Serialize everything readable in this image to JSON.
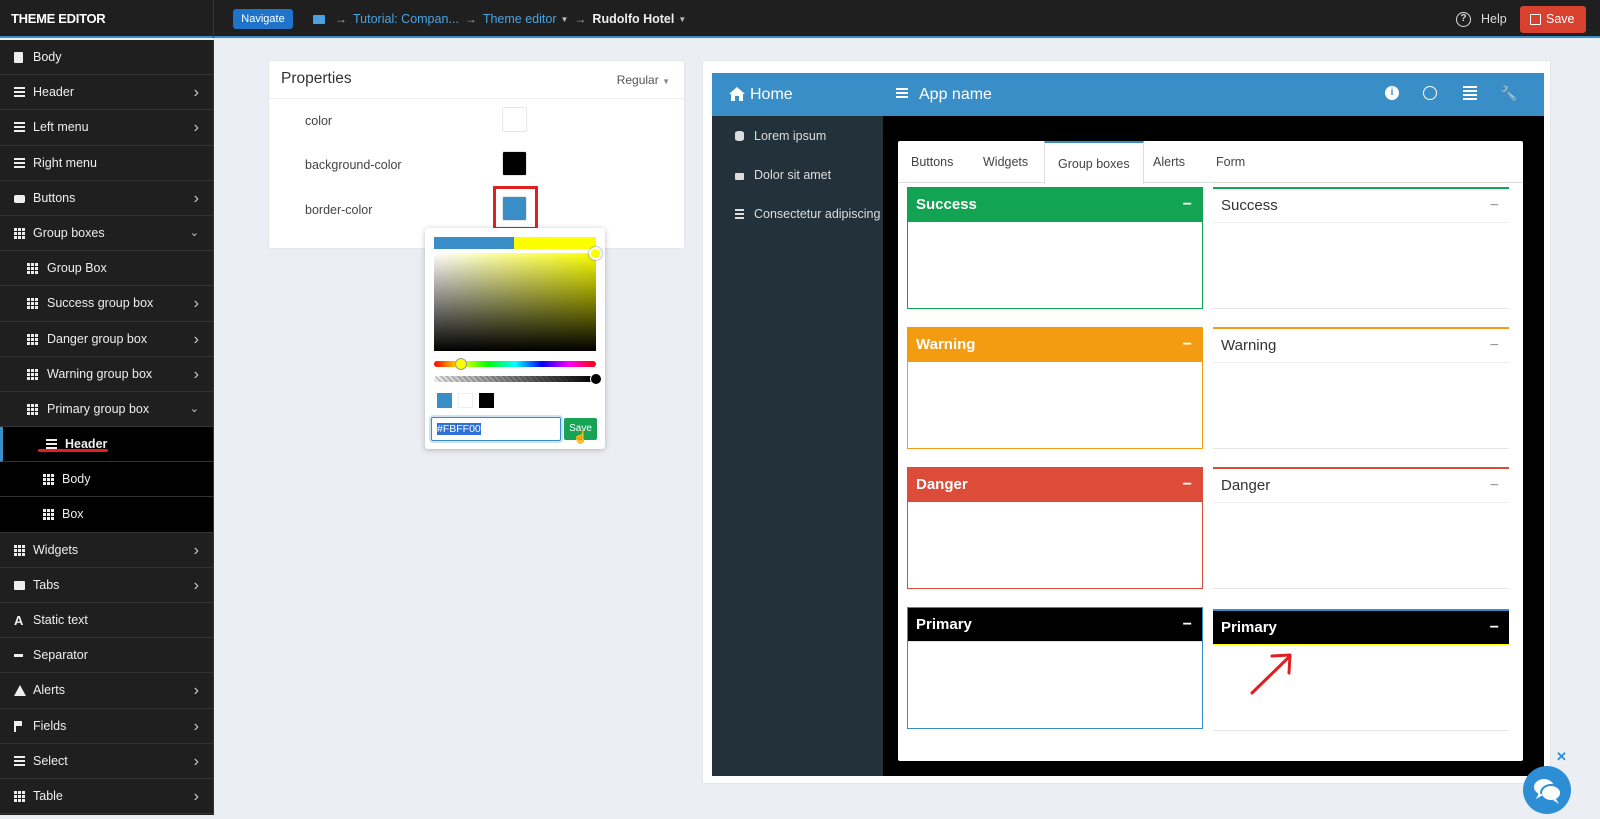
{
  "topbar": {
    "brand": "THEME EDITOR",
    "navigate": "Navigate",
    "crumb1": "Tutorial: Compan...",
    "crumb2": "Theme editor",
    "crumb3": "Rudolfo Hotel",
    "help": "Help",
    "save": "Save"
  },
  "sidebar": {
    "items": [
      {
        "label": "Body",
        "icon": "file-icon",
        "chev": false
      },
      {
        "label": "Header",
        "icon": "lines-icon",
        "chev": true
      },
      {
        "label": "Left menu",
        "icon": "lines-icon",
        "chev": true
      },
      {
        "label": "Right menu",
        "icon": "lines-icon",
        "chev": false
      },
      {
        "label": "Buttons",
        "icon": "button-icon",
        "chev": true
      },
      {
        "label": "Group boxes",
        "icon": "grid-icon",
        "chev": "down"
      },
      {
        "label": "Group Box",
        "icon": "grid-icon",
        "chev": false
      },
      {
        "label": "Success group box",
        "icon": "grid-icon",
        "chev": true
      },
      {
        "label": "Danger group box",
        "icon": "grid-icon",
        "chev": true
      },
      {
        "label": "Warning group box",
        "icon": "grid-icon",
        "chev": true
      },
      {
        "label": "Primary group box",
        "icon": "grid-icon",
        "chev": "down"
      },
      {
        "label": "Header",
        "icon": "lines-icon",
        "chev": false
      },
      {
        "label": "Body",
        "icon": "grid-icon",
        "chev": false
      },
      {
        "label": "Box",
        "icon": "grid-icon",
        "chev": false
      },
      {
        "label": "Widgets",
        "icon": "grid-icon",
        "chev": true
      },
      {
        "label": "Tabs",
        "icon": "folder-icon",
        "chev": true
      },
      {
        "label": "Static text",
        "icon": "text-icon",
        "chev": false
      },
      {
        "label": "Separator",
        "icon": "dash-icon",
        "chev": false
      },
      {
        "label": "Alerts",
        "icon": "warning-icon",
        "chev": true
      },
      {
        "label": "Fields",
        "icon": "flag-icon",
        "chev": true
      },
      {
        "label": "Select",
        "icon": "list-icon",
        "chev": true
      },
      {
        "label": "Table",
        "icon": "table-icon",
        "chev": true
      }
    ]
  },
  "properties": {
    "title": "Properties",
    "mode": "Regular",
    "rows": [
      {
        "name": "color",
        "value": "#ffffff"
      },
      {
        "name": "background-color",
        "value": "#000000"
      },
      {
        "name": "border-color",
        "value": "#3a8ec7"
      }
    ]
  },
  "picker": {
    "hex": "#FBFF00",
    "save": "Save",
    "presets": [
      "#3a8ec7",
      "#ffffff",
      "#000000"
    ]
  },
  "preview": {
    "home": "Home",
    "app_name": "App name",
    "menu": [
      "Lorem ipsum",
      "Dolor sit amet",
      "Consectetur adipiscing"
    ],
    "tabs": [
      "Buttons",
      "Widgets",
      "Group boxes",
      "Alerts",
      "Form"
    ],
    "active_tab": "Group boxes",
    "boxes": [
      {
        "title": "Success",
        "color": "#12a353"
      },
      {
        "title": "Warning",
        "color": "#f39c12"
      },
      {
        "title": "Danger",
        "color": "#dd4b39"
      },
      {
        "title": "Primary",
        "color": "#000000"
      }
    ],
    "minus": "−"
  }
}
